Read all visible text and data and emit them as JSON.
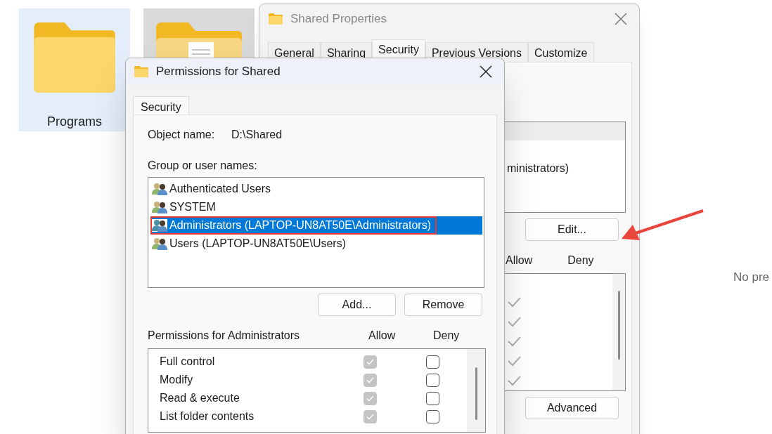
{
  "explorer": {
    "items": [
      {
        "kind": "folder",
        "label": "Programs",
        "selected": true
      },
      {
        "kind": "folder-doc",
        "selected": false
      }
    ],
    "preview_text": "No pre"
  },
  "properties": {
    "title": "Shared Properties",
    "tabs": [
      {
        "label": "General",
        "selected": false
      },
      {
        "label": "Sharing",
        "selected": false
      },
      {
        "label": "Security",
        "selected": true
      },
      {
        "label": "Previous Versions",
        "selected": false
      },
      {
        "label": "Customize",
        "selected": false
      }
    ],
    "group_entry": "ministrators)",
    "edit_button": "Edit...",
    "columns": [
      "Allow",
      "Deny"
    ],
    "allow_checks": [
      true,
      true,
      true,
      true,
      true
    ],
    "advanced_button": "Advanced"
  },
  "permissions": {
    "title": "Permissions for Shared",
    "tabs": [
      {
        "label": "Security",
        "selected": true
      }
    ],
    "object_name_label": "Object name:",
    "object_name": "D:\\Shared",
    "groups_label": "Group or user names:",
    "groups": [
      {
        "name": "Authenticated Users",
        "selected": false,
        "outlined": false
      },
      {
        "name": "SYSTEM",
        "selected": false,
        "outlined": false
      },
      {
        "name": "Administrators (LAPTOP-UN8AT50E\\Administrators)",
        "selected": true,
        "outlined": true
      },
      {
        "name": "Users (LAPTOP-UN8AT50E\\Users)",
        "selected": false,
        "outlined": false
      }
    ],
    "buttons": [
      "Add...",
      "Remove"
    ],
    "permissions_label": "Permissions for Administrators",
    "columns": [
      "Allow",
      "Deny"
    ],
    "rows": [
      {
        "name": "Full control",
        "allow": true,
        "allow_disabled": true,
        "deny": false
      },
      {
        "name": "Modify",
        "allow": true,
        "allow_disabled": true,
        "deny": false
      },
      {
        "name": "Read & execute",
        "allow": true,
        "allow_disabled": true,
        "deny": false
      },
      {
        "name": "List folder contents",
        "allow": true,
        "allow_disabled": true,
        "deny": false
      }
    ]
  }
}
